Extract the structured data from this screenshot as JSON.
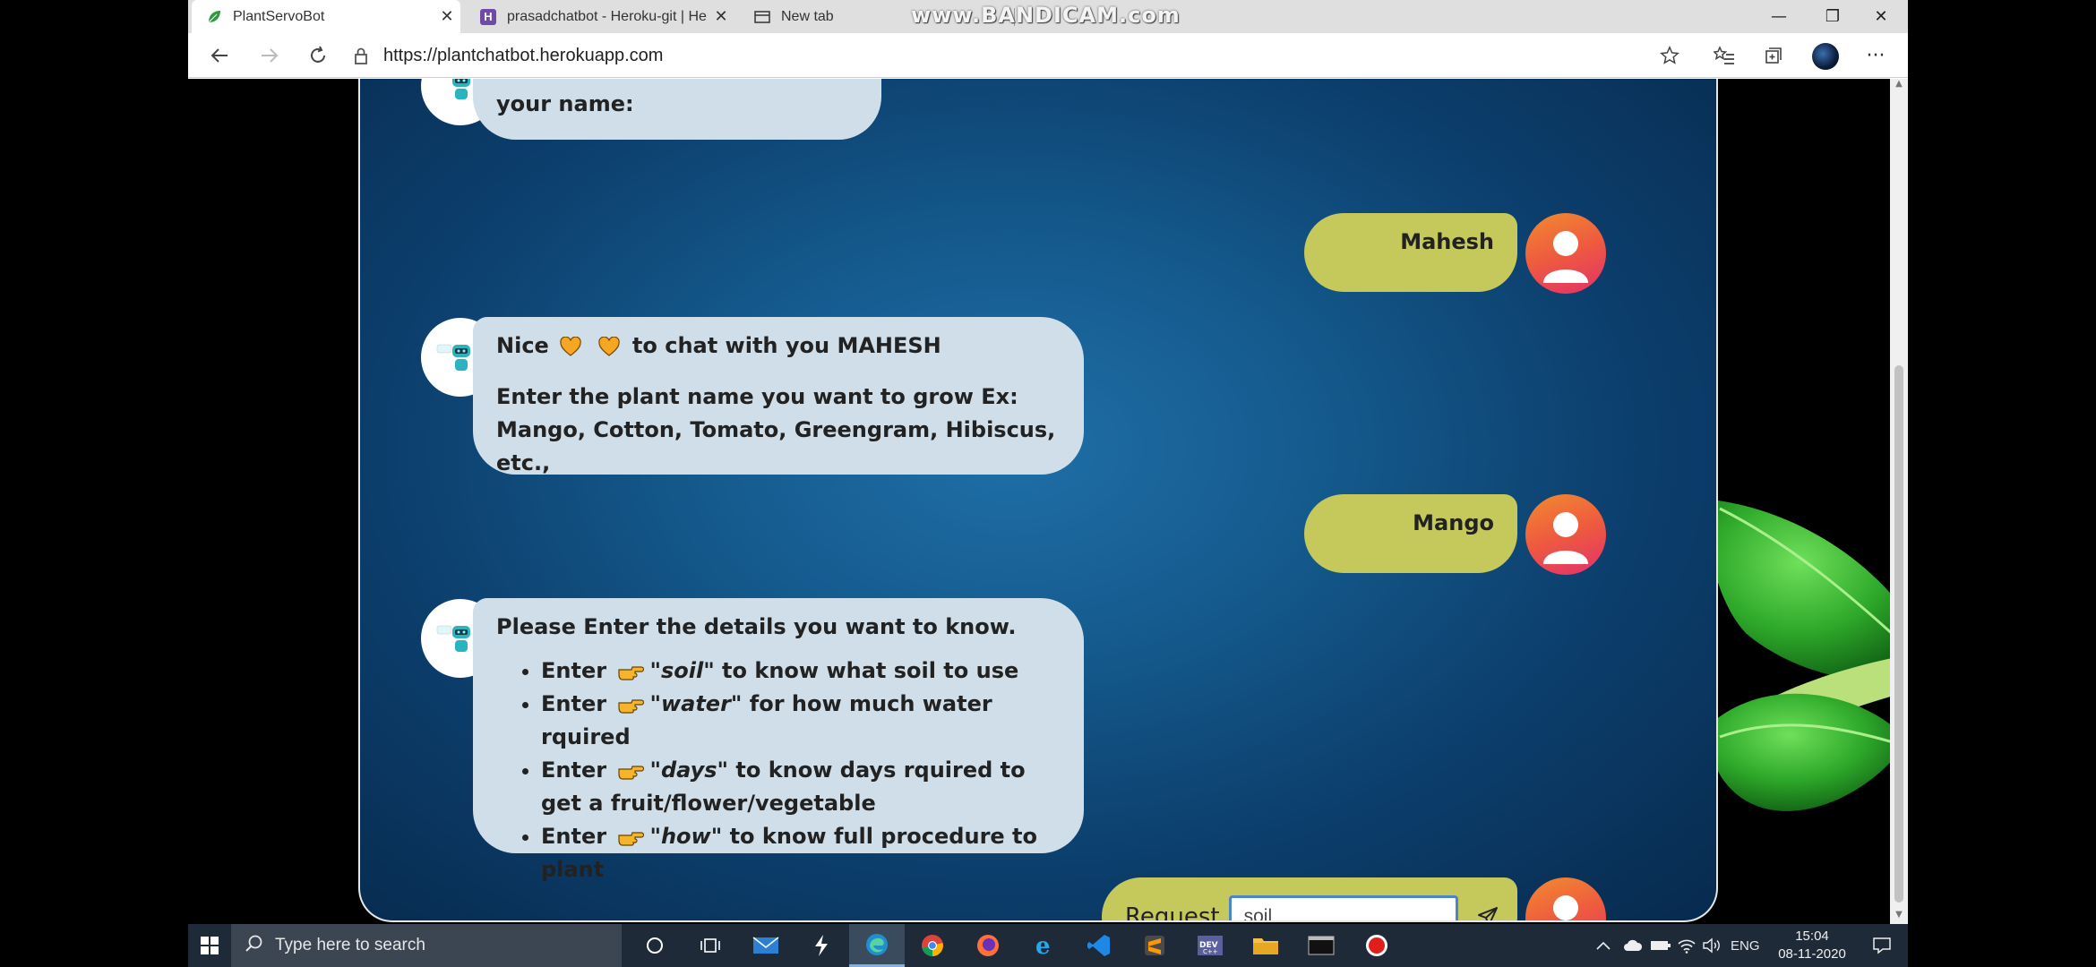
{
  "browser": {
    "tabs": [
      {
        "title": "PlantServoBot",
        "active": true
      },
      {
        "title": "prasadchatbot - Heroku-git | Her",
        "active": false
      },
      {
        "title": "New tab",
        "active": false
      }
    ],
    "url": "https://plantchatbot.herokuapp.com",
    "watermark": "www.BANDICAM.com"
  },
  "chat": {
    "partial_bot_text": "your name:",
    "messages": [
      {
        "from": "user",
        "text": "Mahesh"
      },
      {
        "from": "bot",
        "line1_a": "Nice",
        "line1_b": "to chat with you MAHESH",
        "line2": "Enter the plant name you want to grow Ex: Mango, Cotton, Tomato, Greengram, Hibiscus, etc.,"
      },
      {
        "from": "user",
        "text": "Mango"
      },
      {
        "from": "bot",
        "heading": "Please Enter the details you want to know.",
        "items": [
          {
            "prefix": "Enter",
            "keyword": "soil",
            "suffix": " to know what soil to use"
          },
          {
            "prefix": "Enter",
            "keyword": "water",
            "suffix": " for how much water rquired"
          },
          {
            "prefix": "Enter",
            "keyword": "days",
            "suffix": " to know days rquired to get a fruit/flower/vegetable"
          },
          {
            "prefix": "Enter",
            "keyword": "how",
            "suffix": " to know full procedure to plant"
          }
        ]
      }
    ],
    "request_label": "Request",
    "request_value": "soil"
  },
  "taskbar": {
    "search_placeholder": "Type here to search",
    "language": "ENG",
    "time": "15:04",
    "date": "08-11-2020"
  },
  "colors": {
    "bot_bubble": "#cfdee9",
    "user_bubble": "#c5c85a",
    "chat_bg": "#0c3f6d",
    "avatar_gradient_start": "#f28a2f",
    "avatar_gradient_end": "#e3306b"
  },
  "icons": {
    "back": "arrow-left-icon",
    "forward": "arrow-right-icon",
    "refresh": "refresh-icon",
    "lock": "lock-icon",
    "favorite": "star-icon",
    "collections": "collections-icon",
    "menu": "more-icon",
    "send": "send-icon",
    "pointing_hand": "pointing-hand-icon",
    "heart": "heart-icon"
  }
}
